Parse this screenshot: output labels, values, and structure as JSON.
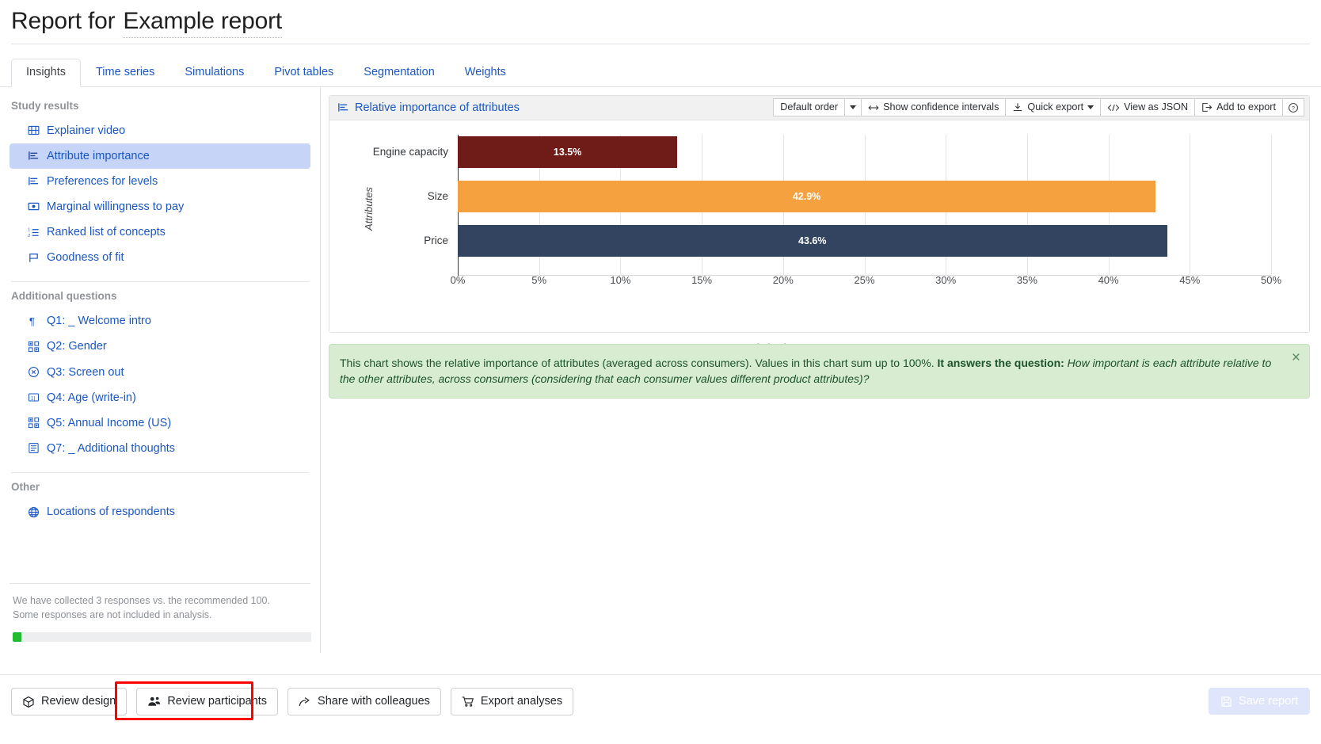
{
  "header": {
    "title_prefix": "Report for",
    "report_name": "Example report"
  },
  "tabs": [
    {
      "label": "Insights",
      "active": true
    },
    {
      "label": "Time series",
      "active": false
    },
    {
      "label": "Simulations",
      "active": false
    },
    {
      "label": "Pivot tables",
      "active": false
    },
    {
      "label": "Segmentation",
      "active": false
    },
    {
      "label": "Weights",
      "active": false
    }
  ],
  "sidebar": {
    "groups": [
      {
        "title": "Study results",
        "items": [
          {
            "label": "Explainer video",
            "icon": "film-icon",
            "selected": false
          },
          {
            "label": "Attribute importance",
            "icon": "bar-chart-icon",
            "selected": true
          },
          {
            "label": "Preferences for levels",
            "icon": "bar-chart-icon",
            "selected": false
          },
          {
            "label": "Marginal willingness to pay",
            "icon": "money-icon",
            "selected": false
          },
          {
            "label": "Ranked list of concepts",
            "icon": "ordered-list-icon",
            "selected": false
          },
          {
            "label": "Goodness of fit",
            "icon": "flag-icon",
            "selected": false
          }
        ]
      },
      {
        "title": "Additional questions",
        "items": [
          {
            "label": "Q1: _ Welcome intro",
            "icon": "paragraph-icon",
            "selected": false
          },
          {
            "label": "Q2: Gender",
            "icon": "choice-grid-icon",
            "selected": false
          },
          {
            "label": "Q3: Screen out",
            "icon": "circle-x-icon",
            "selected": false
          },
          {
            "label": "Q4: Age (write-in)",
            "icon": "number-box-icon",
            "selected": false
          },
          {
            "label": "Q5: Annual Income (US)",
            "icon": "choice-grid-icon",
            "selected": false
          },
          {
            "label": "Q7: _ Additional thoughts",
            "icon": "text-lines-icon",
            "selected": false
          }
        ]
      },
      {
        "title": "Other",
        "items": [
          {
            "label": "Locations of respondents",
            "icon": "globe-icon",
            "selected": false
          }
        ]
      }
    ],
    "footer": {
      "responses_note": "We have collected 3 responses vs. the recommended 100. Some responses are not included in analysis.",
      "progress_percent": 3
    }
  },
  "chart_panel": {
    "heading": "Relative importance of attributes",
    "heading_icon": "bar-chart-icon",
    "toolbar": {
      "order_select_value": "Default order",
      "confidence_label": "Show confidence intervals",
      "confidence_icon": "arrows-horizontal-icon",
      "quick_export_label": "Quick export",
      "quick_export_icon": "download-icon",
      "view_json_label": "View as JSON",
      "view_json_icon": "code-icon",
      "add_export_label": "Add to export",
      "add_export_icon": "export-icon",
      "help_label": "?"
    }
  },
  "chart_data": {
    "type": "bar",
    "orientation": "horizontal",
    "title": "Relative importance of attributes",
    "categories": [
      "Engine capacity",
      "Size",
      "Price"
    ],
    "values": [
      13.5,
      42.9,
      43.6
    ],
    "value_labels": [
      "13.5%",
      "42.9%",
      "43.6%"
    ],
    "colors": [
      "#6f1b18",
      "#f6a140",
      "#324460"
    ],
    "xlabel": "Relative importance",
    "ylabel": "Attributes",
    "xlim": [
      0,
      50
    ],
    "xticks": [
      0,
      5,
      10,
      15,
      20,
      25,
      30,
      35,
      40,
      45,
      50
    ],
    "xtick_labels": [
      "0%",
      "5%",
      "10%",
      "15%",
      "20%",
      "25%",
      "30%",
      "35%",
      "40%",
      "45%",
      "50%"
    ],
    "grid": true,
    "legend": false
  },
  "info_banner": {
    "text_part1": "This chart shows the relative importance of attributes (averaged across consumers). Values in this chart sum up to 100%.",
    "bold_lead": "It answers the question:",
    "italic_question": "How important is each attribute relative to the other attributes, across consumers (considering that each consumer values different product attributes)?",
    "close_label": "×"
  },
  "bottom_bar": {
    "buttons": [
      {
        "label": "Review design",
        "icon": "cube-icon",
        "highlighted": false
      },
      {
        "label": "Review participants",
        "icon": "people-icon",
        "highlighted": true
      },
      {
        "label": "Share with colleagues",
        "icon": "share-icon",
        "highlighted": false
      },
      {
        "label": "Export analyses",
        "icon": "cart-icon",
        "highlighted": false
      }
    ],
    "save_label": "Save report",
    "save_icon": "save-icon",
    "save_disabled": true
  },
  "colors": {
    "link": "#1a57c4",
    "selected_item_bg": "#c5d4f7",
    "banner_bg": "#d7ecd1",
    "banner_text": "#1d5429",
    "highlight": "#ff0000",
    "progress": "#22bb33"
  }
}
